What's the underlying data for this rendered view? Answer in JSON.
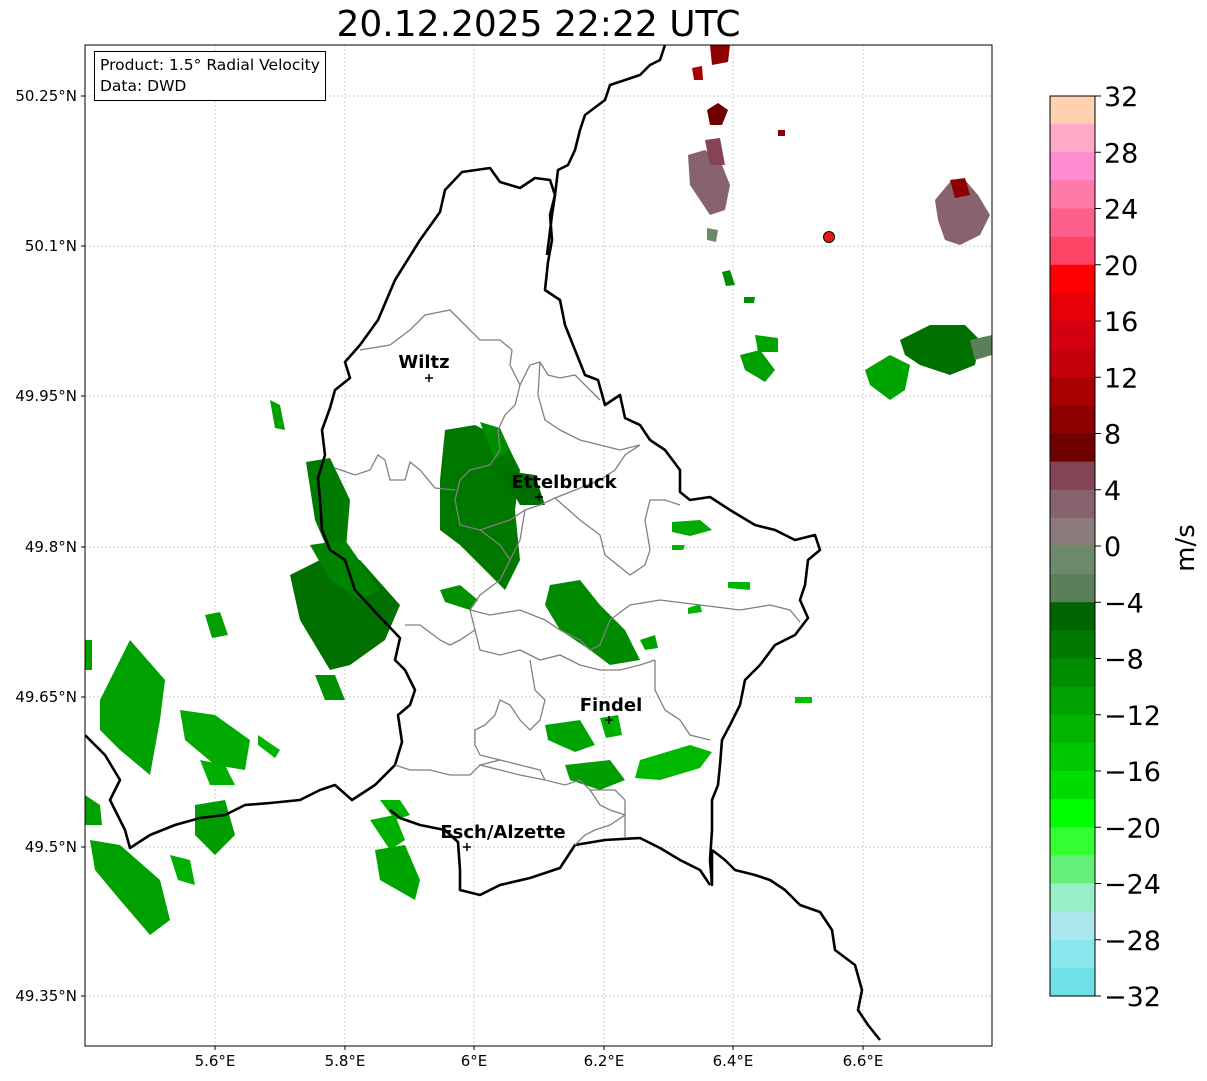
{
  "title": "20.12.2025 22:22 UTC",
  "info": {
    "product": "Product: 1.5° Radial Velocity",
    "data": "Data: DWD"
  },
  "axes": {
    "x_ticks": [
      "5.6°E",
      "5.8°E",
      "6°E",
      "6.2°E",
      "6.4°E",
      "6.6°E"
    ],
    "y_ticks": [
      "50.25°N",
      "50.1°N",
      "49.95°N",
      "49.8°N",
      "49.65°N",
      "49.5°N",
      "49.35°N"
    ]
  },
  "cities": [
    {
      "name": "Wiltz"
    },
    {
      "name": "Ettelbruck"
    },
    {
      "name": "Findel"
    },
    {
      "name": "Esch/Alzette"
    }
  ],
  "colorbar": {
    "unit": "m/s",
    "tick_labels": [
      "32",
      "28",
      "24",
      "20",
      "16",
      "12",
      "8",
      "4",
      "0",
      "−4",
      "−8",
      "−12",
      "−16",
      "−20",
      "−24",
      "−28",
      "−32"
    ],
    "colors_top_to_bottom": [
      "#ffd1b1",
      "#ffa9c8",
      "#ff8ccf",
      "#ff7aa7",
      "#ff5f8c",
      "#ff4468",
      "#ff0000",
      "#e6000a",
      "#d40012",
      "#c4000c",
      "#a80000",
      "#8e0000",
      "#6e0000",
      "#844453",
      "#87636f",
      "#8b7b7b",
      "#6b8a6b",
      "#5b7e5b",
      "#006400",
      "#007a00",
      "#008e00",
      "#00a000",
      "#00b400",
      "#00c800",
      "#00dc00",
      "#00ff00",
      "#33ff33",
      "#66f07a",
      "#99f0c8",
      "#aae8ee",
      "#88e8ee",
      "#70e0e8"
    ]
  },
  "legend_colors": {
    "border": "#000000",
    "admin_border": "#808080",
    "grid": "#b0b0b0",
    "radar_site": "#e31a1c"
  }
}
